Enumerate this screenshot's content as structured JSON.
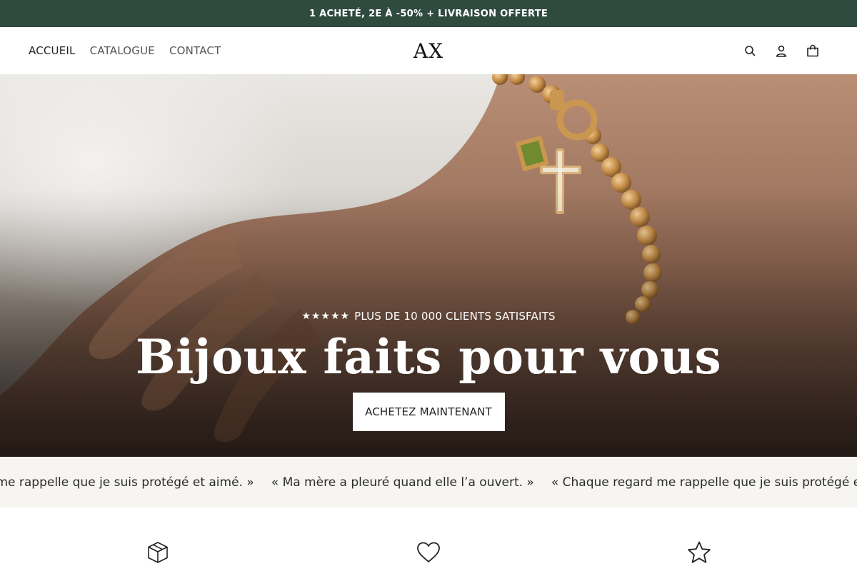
{
  "announcement": {
    "text": "1 ACHETÉ, 2E À -50% + LIVRAISON OFFERTE"
  },
  "header": {
    "nav": [
      {
        "label": "ACCUEIL"
      },
      {
        "label": "CATALOGUE"
      },
      {
        "label": "CONTACT"
      }
    ],
    "logo": "AX",
    "icons": [
      "search-icon",
      "account-icon",
      "cart-icon"
    ]
  },
  "hero": {
    "rating_stars": "★★★★★",
    "rating_text": "PLUS DE 10 000 CLIENTS SATISFAITS",
    "title": "Bijoux faits pour vous",
    "cta_label": "ACHETEZ MAINTENANT"
  },
  "testimonials": {
    "items": [
      "« Chaque regard me rappelle que je suis protégé et aimé. »",
      "« Ma mère a pleuré quand elle l’a ouvert. »",
      "« Chaque regard me rappelle que je suis protégé et aimé. »"
    ]
  },
  "features": {
    "icons": [
      "box-icon",
      "heart-icon",
      "star-icon"
    ]
  },
  "colors": {
    "announcement_bg": "#2f4a3f",
    "marquee_bg": "#f7f5f2",
    "gold": "#c9974f"
  }
}
